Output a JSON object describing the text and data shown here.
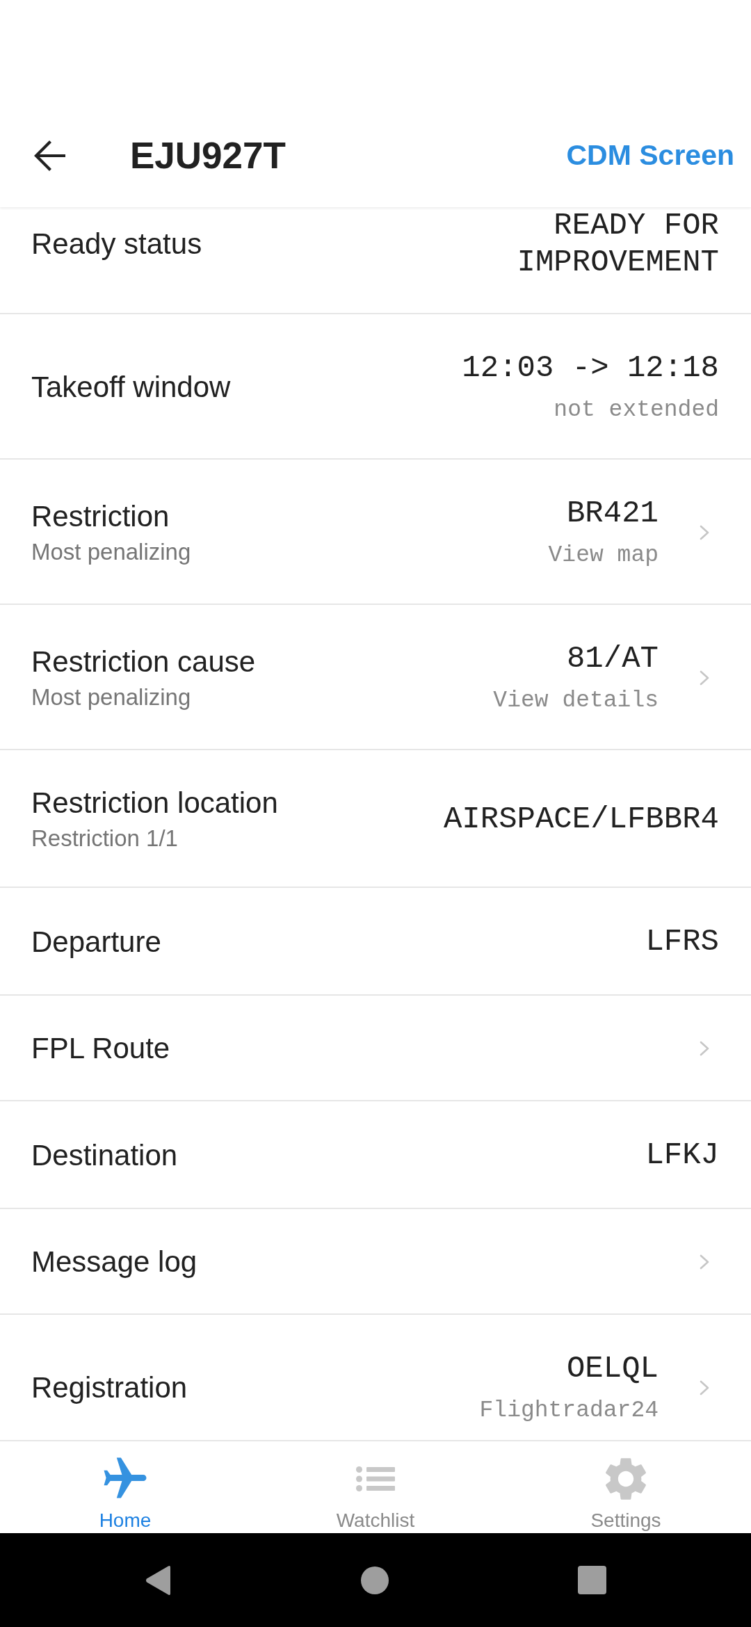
{
  "header": {
    "title": "EJU927T",
    "action": "CDM Screen"
  },
  "rows": [
    {
      "label": "Ready status",
      "value": "READY FOR IMPROVEMENT",
      "chevron": false
    },
    {
      "label": "Takeoff window",
      "value": "12:03 -> 12:18",
      "value_note": "not extended",
      "chevron": false
    },
    {
      "label": "Restriction",
      "sublabel": "Most penalizing",
      "value": "BR421",
      "value_note": "View map",
      "chevron": true
    },
    {
      "label": "Restriction cause",
      "sublabel": "Most penalizing",
      "value": "81/AT",
      "value_note": "View details",
      "chevron": true
    },
    {
      "label": "Restriction location",
      "sublabel": "Restriction 1/1",
      "value": "AIRSPACE/LFBBR4",
      "chevron": false
    },
    {
      "label": "Departure",
      "value": "LFRS",
      "chevron": false
    },
    {
      "label": "FPL Route",
      "chevron": true
    },
    {
      "label": "Destination",
      "value": "LFKJ",
      "chevron": false
    },
    {
      "label": "Message log",
      "chevron": true
    },
    {
      "label": "Registration",
      "value": "OELQL",
      "value_note": "Flightradar24",
      "chevron": true
    }
  ],
  "bottom_nav": [
    {
      "label": "Home",
      "selected": true
    },
    {
      "label": "Watchlist",
      "selected": false
    },
    {
      "label": "Settings",
      "selected": false
    }
  ]
}
